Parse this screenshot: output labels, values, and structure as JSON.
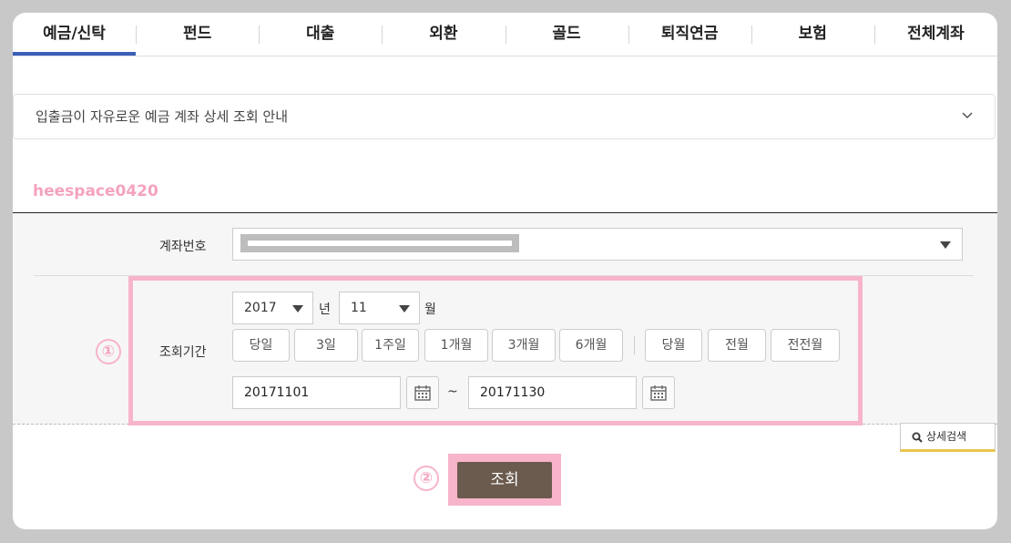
{
  "tabs": [
    {
      "label": "예금/신탁",
      "active": true
    },
    {
      "label": "펀드"
    },
    {
      "label": "대출"
    },
    {
      "label": "외환"
    },
    {
      "label": "골드"
    },
    {
      "label": "퇴직연금"
    },
    {
      "label": "보험"
    },
    {
      "label": "전체계좌"
    }
  ],
  "info": {
    "text": "입출금이 자유로운 예금 계좌 상세 조회 안내",
    "icon": "chevron-down-icon"
  },
  "watermark": "heespace0420",
  "form": {
    "account_label": "계좌번호",
    "period_label": "조회기간",
    "year": "2017",
    "year_unit": "년",
    "month": "11",
    "month_unit": "월",
    "quick_buttons": [
      "당일",
      "3일",
      "1주일",
      "1개월",
      "3개월",
      "6개월",
      "당월",
      "전월",
      "전전월"
    ],
    "start_date": "20171101",
    "tilde": "~",
    "end_date": "20171130",
    "detail_search": "상세검색"
  },
  "markers": {
    "one": "①",
    "two": "②"
  },
  "submit_label": "조회",
  "colors": {
    "highlight": "#f7b4ca",
    "submit": "#6b5a4e",
    "tab_active": "#3b5fb8"
  }
}
